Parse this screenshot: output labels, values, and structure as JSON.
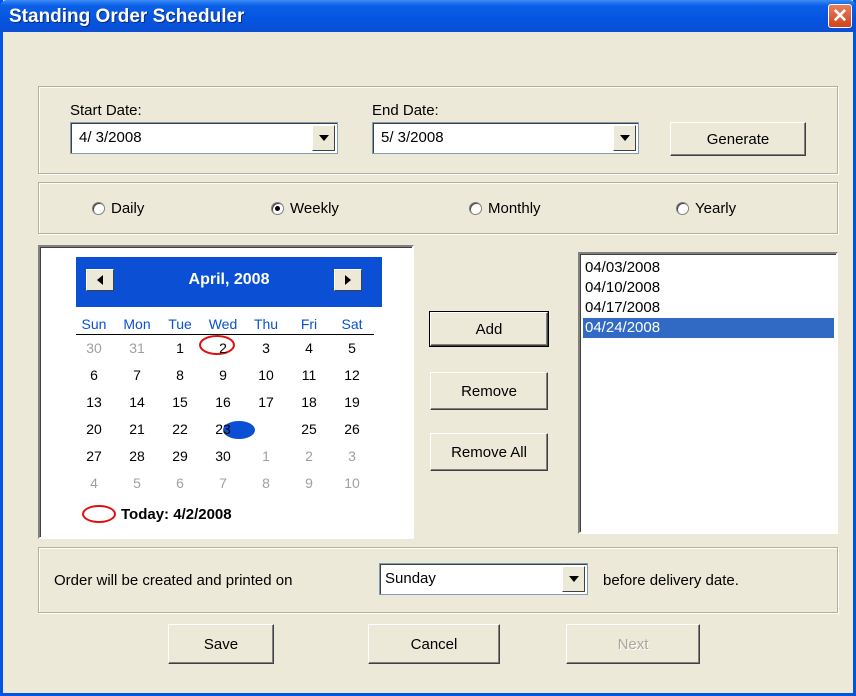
{
  "window": {
    "title": "Standing Order Scheduler"
  },
  "dates": {
    "start_label": "Start Date:",
    "start_value": "4/ 3/2008",
    "end_label": "End Date:",
    "end_value": "5/ 3/2008",
    "generate_label": "Generate"
  },
  "frequency": {
    "options": [
      "Daily",
      "Weekly",
      "Monthly",
      "Yearly"
    ],
    "selected": "Weekly"
  },
  "calendar": {
    "month_label": "April, 2008",
    "weekdays": [
      "Sun",
      "Mon",
      "Tue",
      "Wed",
      "Thu",
      "Fri",
      "Sat"
    ],
    "weeks": [
      [
        "30",
        "31",
        "1",
        "2",
        "3",
        "4",
        "5"
      ],
      [
        "6",
        "7",
        "8",
        "9",
        "10",
        "11",
        "12"
      ],
      [
        "13",
        "14",
        "15",
        "16",
        "17",
        "18",
        "19"
      ],
      [
        "20",
        "21",
        "22",
        "23",
        "24",
        "25",
        "26"
      ],
      [
        "27",
        "28",
        "29",
        "30",
        "1",
        "2",
        "3"
      ],
      [
        "4",
        "5",
        "6",
        "7",
        "8",
        "9",
        "10"
      ]
    ],
    "selected_day": "24",
    "today_day": "2",
    "today_label": "Today: 4/2/2008"
  },
  "actions": {
    "add_label": "Add",
    "remove_label": "Remove",
    "remove_all_label": "Remove All"
  },
  "schedule_list": {
    "items": [
      "04/03/2008",
      "04/10/2008",
      "04/17/2008",
      "04/24/2008"
    ],
    "selected": "04/24/2008"
  },
  "print_day": {
    "prefix": "Order will be created and printed on",
    "value": "Sunday",
    "suffix": "before delivery date."
  },
  "footer": {
    "save_label": "Save",
    "cancel_label": "Cancel",
    "next_label": "Next"
  },
  "colors": {
    "title_bar": "#0a4fd4",
    "selection": "#316ac5",
    "today_marker": "#e01010",
    "face": "#ece9d8"
  }
}
